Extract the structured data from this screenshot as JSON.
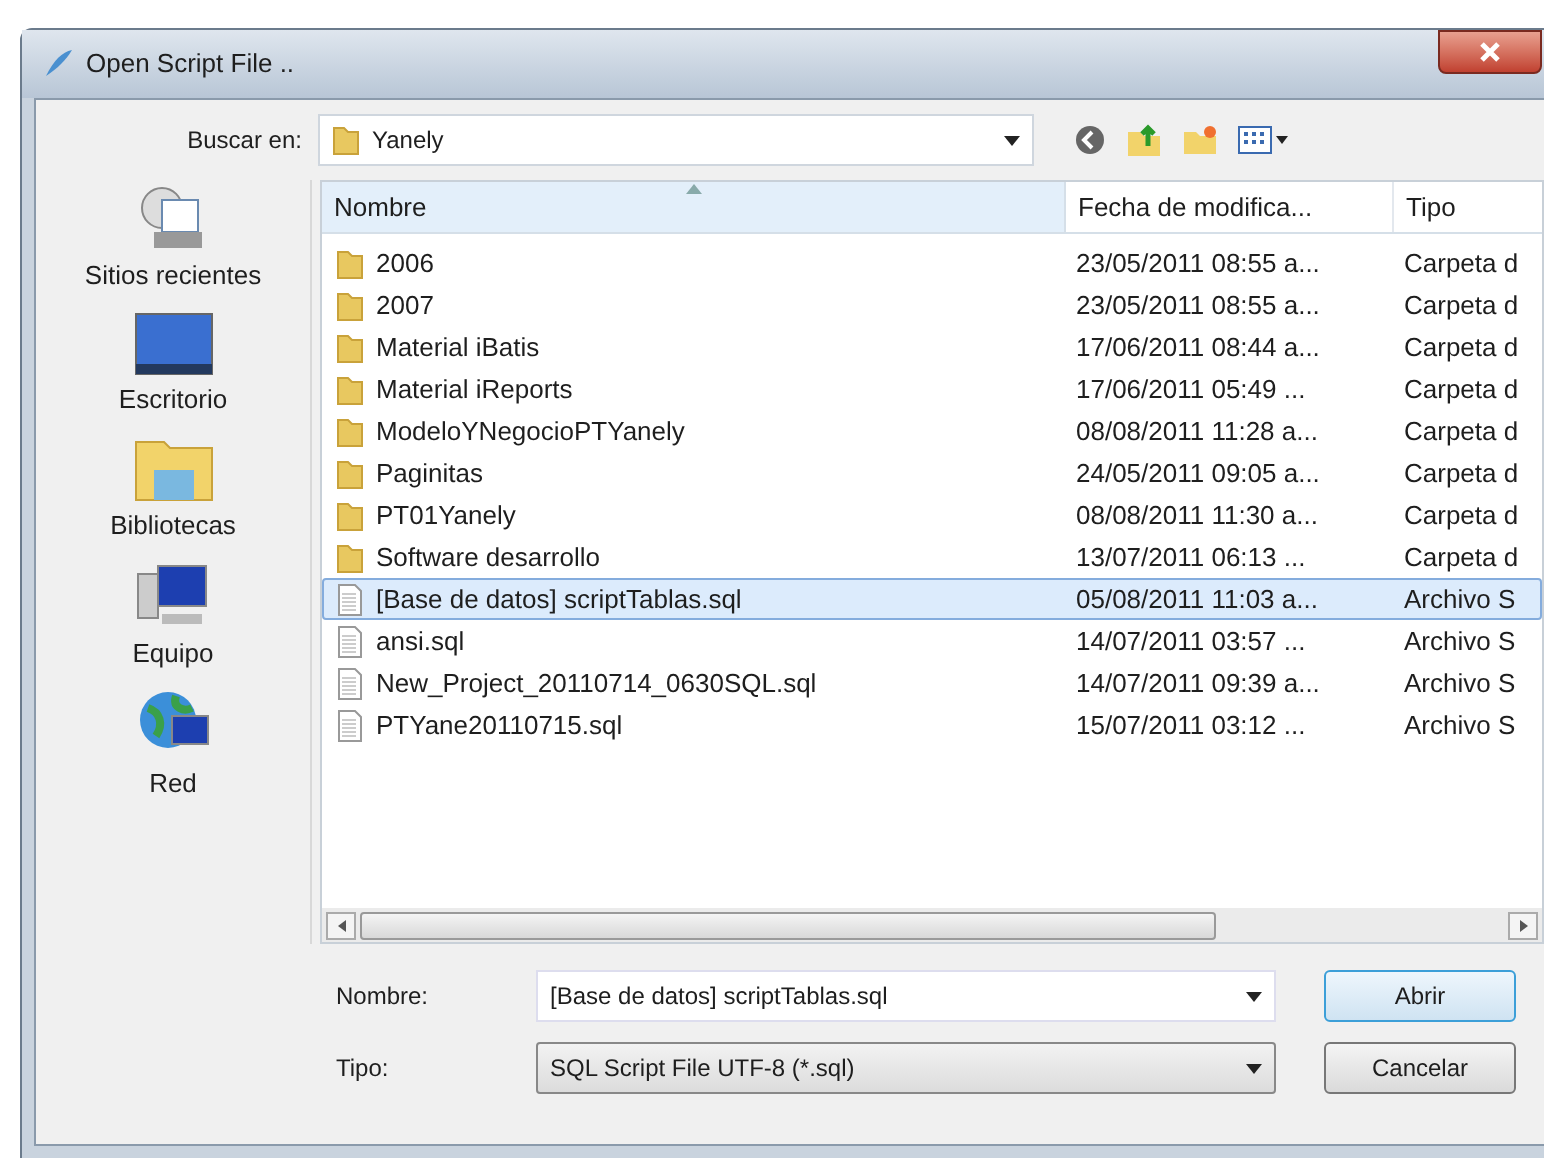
{
  "window": {
    "title": "Open Script File .."
  },
  "look_in": {
    "label": "Buscar en:",
    "value": "Yanely"
  },
  "places": [
    {
      "label": "Sitios recientes",
      "kind": "recent"
    },
    {
      "label": "Escritorio",
      "kind": "desktop"
    },
    {
      "label": "Bibliotecas",
      "kind": "libraries"
    },
    {
      "label": "Equipo",
      "kind": "computer"
    },
    {
      "label": "Red",
      "kind": "network"
    }
  ],
  "table": {
    "columns": [
      "Nombre",
      "Fecha de modifica...",
      "Tipo"
    ],
    "rows": [
      {
        "kind": "folder",
        "name": "2006",
        "date": "23/05/2011 08:55 a...",
        "type": "Carpeta d",
        "selected": false
      },
      {
        "kind": "folder",
        "name": "2007",
        "date": "23/05/2011 08:55 a...",
        "type": "Carpeta d",
        "selected": false
      },
      {
        "kind": "folder",
        "name": "Material iBatis",
        "date": "17/06/2011 08:44 a...",
        "type": "Carpeta d",
        "selected": false
      },
      {
        "kind": "folder",
        "name": "Material iReports",
        "date": "17/06/2011 05:49 ...",
        "type": "Carpeta d",
        "selected": false
      },
      {
        "kind": "folder",
        "name": "ModeloYNegocioPTYanely",
        "date": "08/08/2011 11:28 a...",
        "type": "Carpeta d",
        "selected": false
      },
      {
        "kind": "folder",
        "name": "Paginitas",
        "date": "24/05/2011 09:05 a...",
        "type": "Carpeta d",
        "selected": false
      },
      {
        "kind": "folder",
        "name": "PT01Yanely",
        "date": "08/08/2011 11:30 a...",
        "type": "Carpeta d",
        "selected": false
      },
      {
        "kind": "folder",
        "name": "Software desarrollo",
        "date": "13/07/2011 06:13 ...",
        "type": "Carpeta d",
        "selected": false
      },
      {
        "kind": "file",
        "name": "[Base de datos] scriptTablas.sql",
        "date": "05/08/2011 11:03 a...",
        "type": "Archivo S",
        "selected": true
      },
      {
        "kind": "file",
        "name": "ansi.sql",
        "date": "14/07/2011 03:57 ...",
        "type": "Archivo S",
        "selected": false
      },
      {
        "kind": "file",
        "name": "New_Project_20110714_0630SQL.sql",
        "date": "14/07/2011 09:39 a...",
        "type": "Archivo S",
        "selected": false
      },
      {
        "kind": "file",
        "name": "PTYane20110715.sql",
        "date": "15/07/2011 03:12 ...",
        "type": "Archivo S",
        "selected": false
      }
    ]
  },
  "file_name": {
    "label": "Nombre:",
    "value": "[Base de datos] scriptTablas.sql"
  },
  "file_type": {
    "label": "Tipo:",
    "value": "SQL Script File UTF-8 (*.sql)"
  },
  "buttons": [
    "Abrir",
    "Cancelar"
  ]
}
